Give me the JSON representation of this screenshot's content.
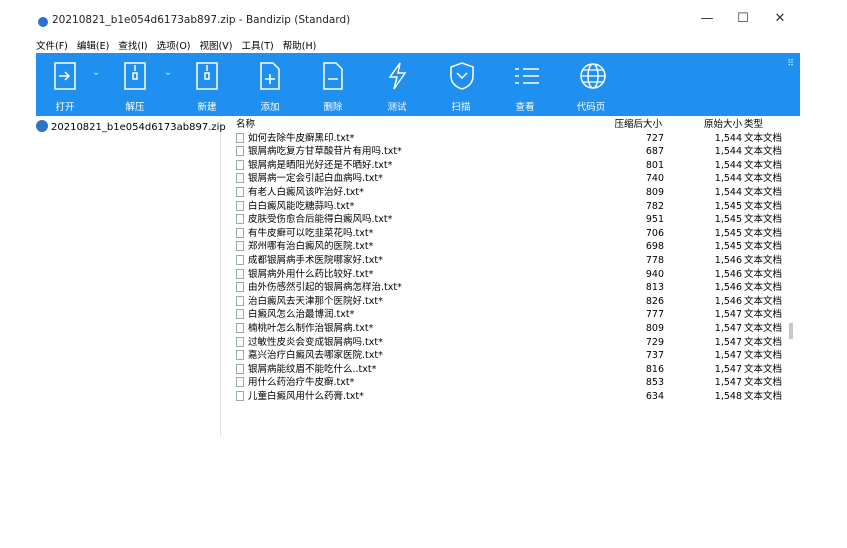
{
  "window": {
    "title": "20210821_b1e054d6173ab897.zip - Bandizip (Standard)",
    "controls": {
      "minimize": "—",
      "maximize": "☐",
      "close": "✕"
    }
  },
  "menu": [
    "文件(F)",
    "编辑(E)",
    "查找(I)",
    "选项(O)",
    "视图(V)",
    "工具(T)",
    "帮助(H)"
  ],
  "toolbar": {
    "color": "#1f8ff0",
    "buttons": [
      {
        "label": "打开",
        "icon": "open-archive-icon"
      },
      {
        "label": "解压",
        "icon": "extract-icon"
      },
      {
        "label": "新建",
        "icon": "new-archive-icon"
      },
      {
        "label": "添加",
        "icon": "add-file-icon"
      },
      {
        "label": "删除",
        "icon": "delete-file-icon"
      },
      {
        "label": "测试",
        "icon": "test-icon"
      },
      {
        "label": "扫描",
        "icon": "scan-icon"
      },
      {
        "label": "查看",
        "icon": "view-icon"
      },
      {
        "label": "代码页",
        "icon": "codepage-icon"
      }
    ]
  },
  "sidebar": {
    "item": "20210821_b1e054d6173ab897.zip"
  },
  "table": {
    "headers": {
      "name": "名称",
      "compressed": "压缩后大小",
      "original": "原始大小",
      "type": "类型"
    },
    "rows": [
      {
        "name": "如何去除牛皮癣黑印.txt*",
        "compressed": "727",
        "original": "1,544",
        "type": "文本文档"
      },
      {
        "name": "银屑病吃复方甘草酸苷片有用吗.txt*",
        "compressed": "687",
        "original": "1,544",
        "type": "文本文档"
      },
      {
        "name": "银屑病是晒阳光好还是不晒好.txt*",
        "compressed": "801",
        "original": "1,544",
        "type": "文本文档"
      },
      {
        "name": "银屑病一定会引起白血病吗.txt*",
        "compressed": "740",
        "original": "1,544",
        "type": "文本文档"
      },
      {
        "name": "有老人白癜风该咋治好.txt*",
        "compressed": "809",
        "original": "1,544",
        "type": "文本文档"
      },
      {
        "name": "白白癜风能吃糖蒜吗.txt*",
        "compressed": "782",
        "original": "1,545",
        "type": "文本文档"
      },
      {
        "name": "皮肤受伤愈合后能得白癜风吗.txt*",
        "compressed": "951",
        "original": "1,545",
        "type": "文本文档"
      },
      {
        "name": "有牛皮癣可以吃韭菜花吗.txt*",
        "compressed": "706",
        "original": "1,545",
        "type": "文本文档"
      },
      {
        "name": "郑州哪有治白癜风的医院.txt*",
        "compressed": "698",
        "original": "1,545",
        "type": "文本文档"
      },
      {
        "name": "成都银屑病手术医院哪家好.txt*",
        "compressed": "778",
        "original": "1,546",
        "type": "文本文档"
      },
      {
        "name": "银屑病外用什么药比较好.txt*",
        "compressed": "940",
        "original": "1,546",
        "type": "文本文档"
      },
      {
        "name": "由外伤感然引起的银屑病怎样治.txt*",
        "compressed": "813",
        "original": "1,546",
        "type": "文本文档"
      },
      {
        "name": "治白癜风去天津那个医院好.txt*",
        "compressed": "826",
        "original": "1,546",
        "type": "文本文档"
      },
      {
        "name": "白癜风怎么治最博润.txt*",
        "compressed": "777",
        "original": "1,547",
        "type": "文本文档"
      },
      {
        "name": "楠桃叶怎么制作治银屑病.txt*",
        "compressed": "809",
        "original": "1,547",
        "type": "文本文档"
      },
      {
        "name": "过敏性皮炎会变成银屑病吗.txt*",
        "compressed": "729",
        "original": "1,547",
        "type": "文本文档"
      },
      {
        "name": "嘉兴治疗白癜风去哪家医院.txt*",
        "compressed": "737",
        "original": "1,547",
        "type": "文本文档"
      },
      {
        "name": "银屑病能纹眉不能吃什么..txt*",
        "compressed": "816",
        "original": "1,547",
        "type": "文本文档"
      },
      {
        "name": "用什么药治疗牛皮癣.txt*",
        "compressed": "853",
        "original": "1,547",
        "type": "文本文档"
      },
      {
        "name": "儿童白癜风用什么药膏.txt*",
        "compressed": "634",
        "original": "1,548",
        "type": "文本文档"
      }
    ]
  }
}
